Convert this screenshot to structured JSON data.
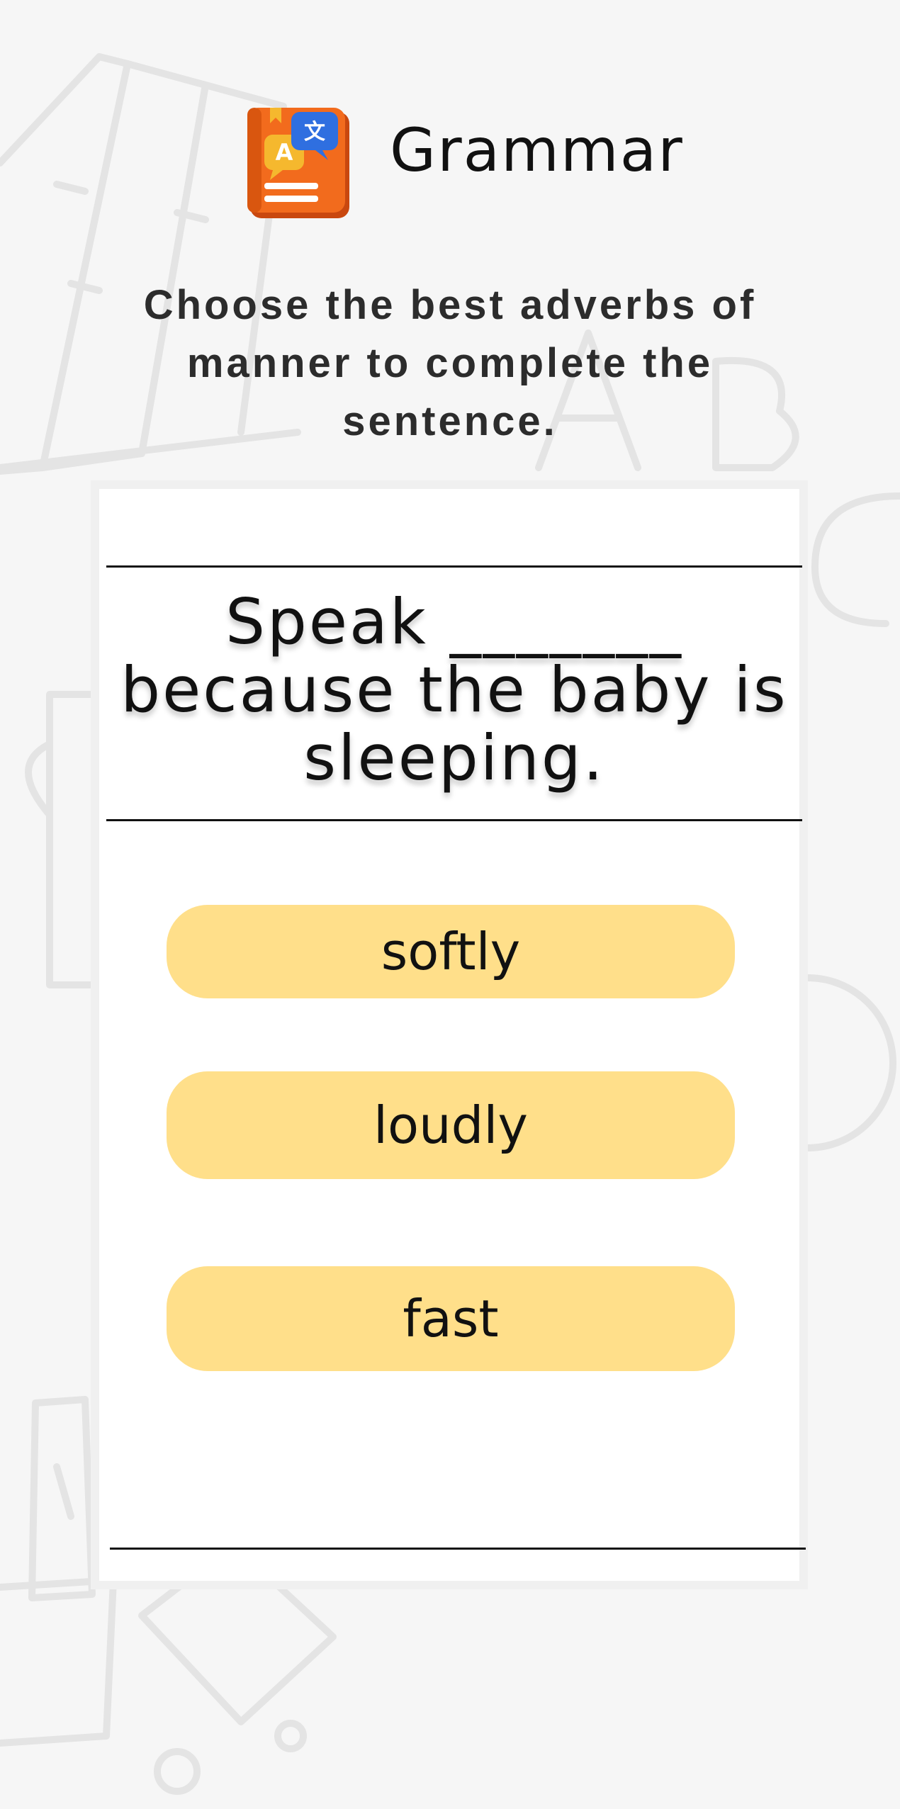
{
  "header": {
    "title": "Grammar",
    "icon": "grammar-book-icon"
  },
  "instruction": "Choose the best adverbs of manner to complete the sentence.",
  "question": {
    "text": "Speak _______ because the baby is sleeping."
  },
  "options": [
    {
      "label": "softly"
    },
    {
      "label": "loudly"
    },
    {
      "label": "fast"
    }
  ],
  "colors": {
    "background": "#f6f6f6",
    "card": "#ffffff",
    "option_fill": "#ffdf8a",
    "icon_book": "#f26b1d",
    "icon_bubble": "#2f6fe0",
    "icon_bubble_alt": "#f5b82e"
  }
}
